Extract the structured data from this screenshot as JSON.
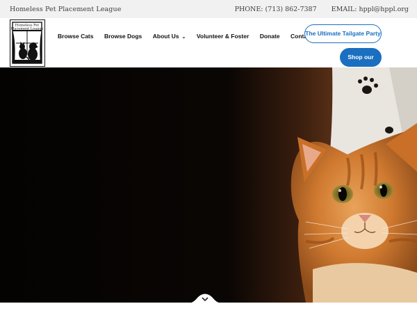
{
  "topbar": {
    "org_name": "Homeless Pet Placement League",
    "phone_label": "PHONE:",
    "phone_value": "(713) 862-7387",
    "email_label": "EMAIL:",
    "email_value": "hppl@hppl.org"
  },
  "logo": {
    "text_line1": "Homeless Pet",
    "text_line2": "Placement League"
  },
  "nav": {
    "items": [
      {
        "label": "Browse Cats"
      },
      {
        "label": "Browse Dogs"
      },
      {
        "label": "About Us",
        "has_dropdown": true
      },
      {
        "label": "Volunteer & Foster"
      },
      {
        "label": "Donate"
      },
      {
        "label": "Contact Us"
      }
    ],
    "dropdown_icon": "chevron-down-icon"
  },
  "buttons": {
    "tailgate_label": "The Ultimate Tailgate Party",
    "store_label": "Shop our Store"
  },
  "hero": {
    "image_subject": "orange tabby cat",
    "scroll_icon": "chevron-down-icon"
  },
  "colors": {
    "accent": "#1a6fc0",
    "topbar_bg": "#f1f1f1",
    "hero_bg": "#050403"
  }
}
